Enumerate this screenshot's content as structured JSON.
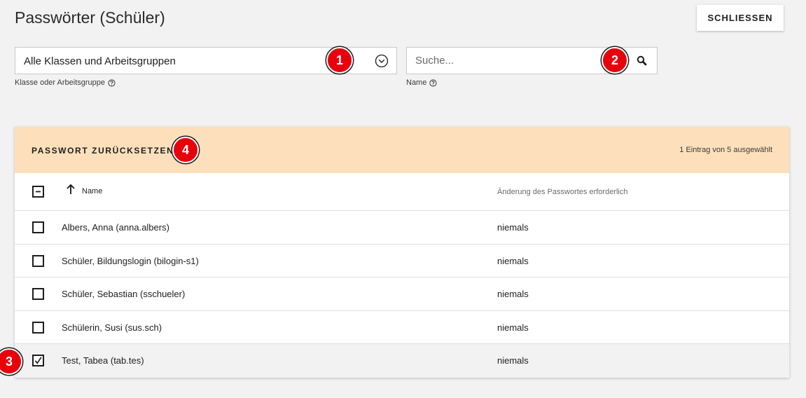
{
  "header": {
    "title": "Passwörter (Schüler)",
    "close_label": "SCHLIESSEN"
  },
  "filter": {
    "group_value": "Alle Klassen und Arbeitsgruppen",
    "group_label": "Klasse oder Arbeitsgruppe",
    "search_placeholder": "Suche...",
    "search_label": "Name"
  },
  "annotations": {
    "b1": "1",
    "b2": "2",
    "b3": "3",
    "b4": "4"
  },
  "table": {
    "action_title": "PASSWORT ZURÜCKSETZEN",
    "selection_info": "1 Eintrag von 5 ausgewählt",
    "columns": {
      "name": "Name",
      "password_change": "Änderung des Passwortes erforderlich"
    },
    "rows": [
      {
        "name": "Albers, Anna (anna.albers)",
        "password_change": "niemals",
        "selected": false
      },
      {
        "name": "Schüler, Bildungslogin (bilogin-s1)",
        "password_change": "niemals",
        "selected": false
      },
      {
        "name": "Schüler, Sebastian (sschueler)",
        "password_change": "niemals",
        "selected": false
      },
      {
        "name": "Schülerin, Susi (sus.sch)",
        "password_change": "niemals",
        "selected": false
      },
      {
        "name": "Test, Tabea (tab.tes)",
        "password_change": "niemals",
        "selected": true
      }
    ]
  },
  "colors": {
    "background": "#f2f2f2",
    "header_band": "#fde0bb",
    "badge": "#e8000b"
  }
}
